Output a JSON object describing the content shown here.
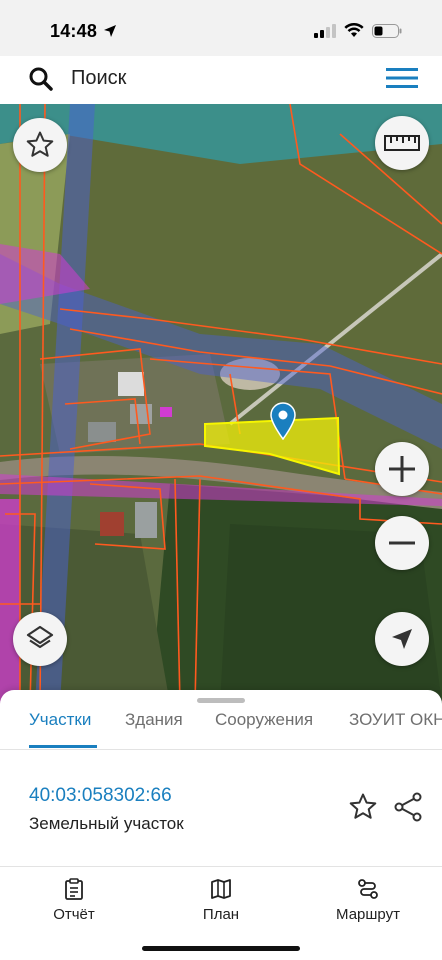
{
  "status_bar": {
    "time": "14:48"
  },
  "search": {
    "placeholder": "Поиск"
  },
  "tabs": [
    {
      "label": "Участки",
      "active": true
    },
    {
      "label": "Здания",
      "active": false
    },
    {
      "label": "Сооружения",
      "active": false
    },
    {
      "label": "ЗОУИТ ОКН",
      "active": false
    }
  ],
  "parcel": {
    "number": "40:03:058302:66",
    "type": "Земельный участок"
  },
  "bottom_nav": [
    {
      "label": "Отчёт",
      "icon": "report-icon"
    },
    {
      "label": "План",
      "icon": "map-plan-icon"
    },
    {
      "label": "Маршрут",
      "icon": "route-icon"
    }
  ],
  "map_controls": [
    "favorite-star-icon",
    "ruler-icon",
    "zoom-in-icon",
    "zoom-out-icon",
    "layers-icon",
    "locate-arrow-icon"
  ],
  "colors": {
    "accent": "#1a7fbf",
    "parcel_fill": "#f2f20a",
    "boundary": "#ff5a1f",
    "zone": "#4a5fd6",
    "overlay": "#d23cd2"
  }
}
